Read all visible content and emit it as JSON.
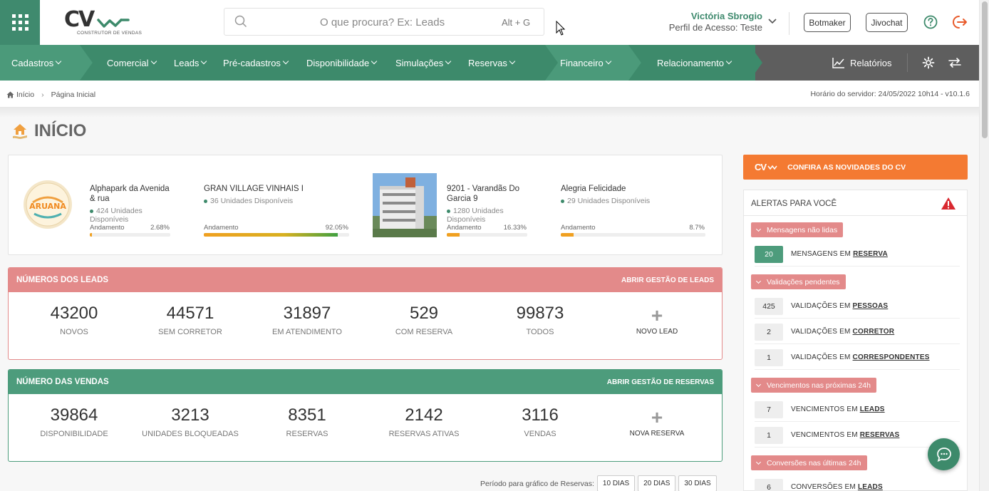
{
  "header": {
    "logo_text": "CV",
    "logo_subtitle": "CONSTRUTOR DE VENDAS",
    "search_placeholder": "O que procura? Ex: Leads",
    "search_shortcut": "Alt + G",
    "user_name": "Victória Sbrogio",
    "user_profile": "Perfil de Acesso: Teste",
    "botmaker_label": "Botmaker",
    "jivochat_label": "Jivochat"
  },
  "nav": {
    "items": [
      {
        "label": "Cadastros"
      },
      {
        "label": "Comercial"
      },
      {
        "label": "Leads"
      },
      {
        "label": "Pré-cadastros"
      },
      {
        "label": "Disponibilidade"
      },
      {
        "label": "Simulações"
      },
      {
        "label": "Reservas"
      },
      {
        "label": "Financeiro"
      },
      {
        "label": "Relacionamento"
      }
    ],
    "reports_label": "Relatórios"
  },
  "breadcrumb": {
    "home": "Início",
    "current": "Página Inicial",
    "server_time": "Horário do servidor: 24/05/2022 10h14 - v10.1.6"
  },
  "page": {
    "title": "INÍCIO"
  },
  "projects": [
    {
      "name": "Alphapark da Avenida & rua",
      "units": "424 Unidades Disponíveis",
      "progress_label": "Andamento",
      "progress_text": "2.68%",
      "progress": 2.68,
      "image_text": "ARUANA"
    },
    {
      "name": "GRAN VILLAGE VINHAIS I",
      "units": "36 Unidades Disponíveis",
      "progress_label": "Andamento",
      "progress_text": "92.05%",
      "progress": 92.05
    },
    {
      "name": "9201 - Varandãs Do Garcia 9",
      "units": "1280 Unidades Disponíveis",
      "progress_label": "Andamento",
      "progress_text": "16.33%",
      "progress": 16.33
    },
    {
      "name": "Alegria Felicidade",
      "units": "29 Unidades Disponíveis",
      "progress_label": "Andamento",
      "progress_text": "8.7%",
      "progress": 8.7
    }
  ],
  "leads": {
    "title": "NÚMEROS DOS LEADS",
    "link": "ABRIR GESTÃO DE LEADS",
    "color": "#e38a8a",
    "stats": [
      {
        "value": "43200",
        "label": "NOVOS"
      },
      {
        "value": "44571",
        "label": "SEM CORRETOR"
      },
      {
        "value": "31897",
        "label": "EM ATENDIMENTO"
      },
      {
        "value": "529",
        "label": "COM RESERVA"
      },
      {
        "value": "99873",
        "label": "TODOS"
      }
    ],
    "add_label": "NOVO LEAD"
  },
  "sales": {
    "title": "NÚMERO DAS VENDAS",
    "link": "ABRIR GESTÃO DE RESERVAS",
    "color": "#4d9c7c",
    "stats": [
      {
        "value": "39864",
        "label": "DISPONIBILIDADE"
      },
      {
        "value": "3213",
        "label": "UNIDADES BLOQUEADAS"
      },
      {
        "value": "8351",
        "label": "RESERVAS"
      },
      {
        "value": "2142",
        "label": "RESERVAS ATIVAS"
      },
      {
        "value": "3116",
        "label": "VENDAS"
      }
    ],
    "add_label": "NOVA RESERVA"
  },
  "period": {
    "label": "Período para gráfico de Reservas:",
    "options": [
      "10 DIAS",
      "20 DIAS",
      "30 DIAS"
    ]
  },
  "news": {
    "logo": "CV",
    "label": "CONFIRA AS NOVIDADES DO CV"
  },
  "alerts": {
    "title": "ALERTAS PARA VOCÊ",
    "groups": [
      {
        "tag": "Mensagens não lidas",
        "rows": [
          {
            "count": "20",
            "text": "MENSAGENS EM",
            "link": "RESERVA"
          }
        ]
      },
      {
        "tag": "Validações pendentes",
        "rows": [
          {
            "count": "425",
            "text": "VALIDAÇÕES EM",
            "link": "PESSOAS"
          },
          {
            "count": "2",
            "text": "VALIDAÇÕES EM",
            "link": "CORRETOR"
          },
          {
            "count": "1",
            "text": "VALIDAÇÕES EM",
            "link": "CORRESPONDENTES"
          }
        ]
      },
      {
        "tag": "Vencimentos nas próximas 24h",
        "rows": [
          {
            "count": "7",
            "text": "VENCIMENTOS EM",
            "link": "LEADS"
          },
          {
            "count": "1",
            "text": "VENCIMENTOS EM",
            "link": "RESERVAS"
          }
        ]
      },
      {
        "tag": "Conversões nas últimas 24h",
        "rows": [
          {
            "count": "6",
            "text": "CONVERSÕES EM",
            "link": "LEADS"
          }
        ]
      }
    ]
  },
  "colors": {
    "brand_green": "#3d8a6b",
    "accent_orange": "#f47a32",
    "leads_red": "#e38a8a",
    "dark_gray": "#5e5e5e"
  }
}
